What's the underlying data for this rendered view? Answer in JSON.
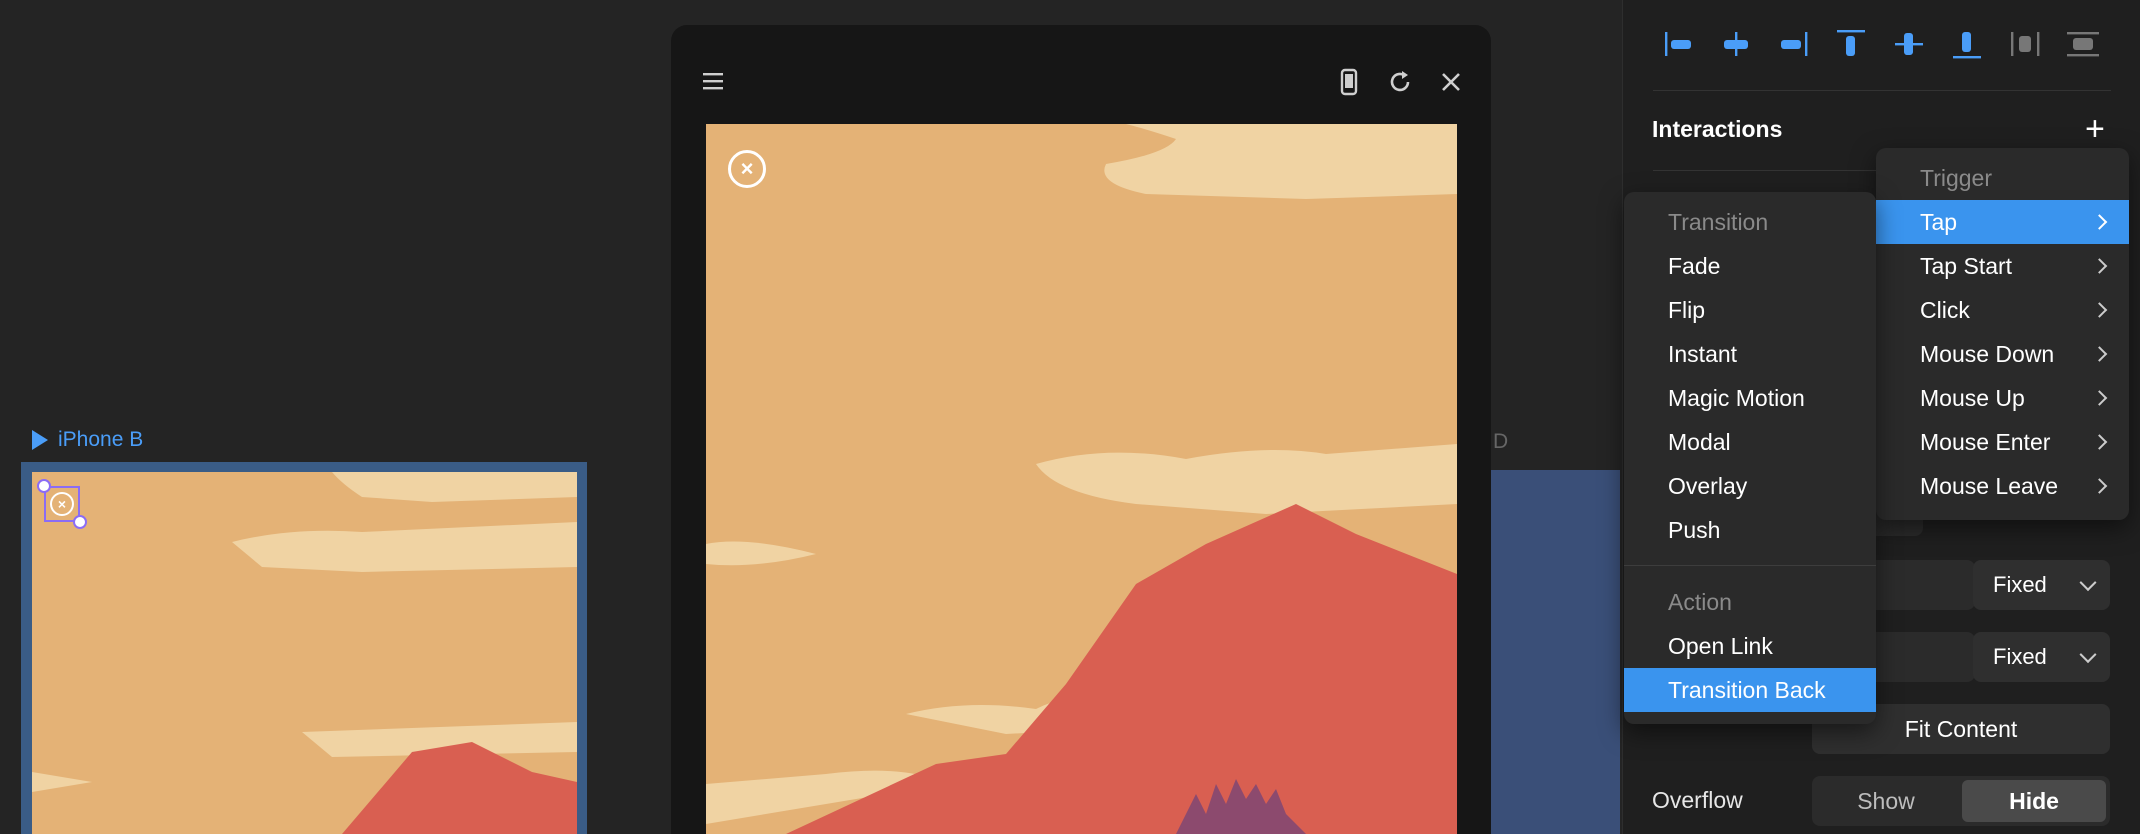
{
  "canvas": {
    "frame_b_label": "iPhone B",
    "frame_d_label": "D"
  },
  "preview": {
    "menu_icon": "menu-icon",
    "device_icon": "device-icon",
    "refresh_icon": "refresh-icon",
    "close_icon": "close-icon",
    "close_glyph": "×"
  },
  "panel": {
    "interactions_title": "Interactions",
    "add_symbol": "+",
    "size_width_mode": "Fixed",
    "size_height_mode": "Fixed",
    "fit_content_label": "Fit Content",
    "overflow_label": "Overflow",
    "overflow_options": [
      "Show",
      "Hide"
    ],
    "overflow_selected": "Hide"
  },
  "trigger_menu": {
    "header": "Trigger",
    "items": [
      "Tap",
      "Tap Start",
      "Click",
      "Mouse Down",
      "Mouse Up",
      "Mouse Enter",
      "Mouse Leave"
    ],
    "selected": "Tap"
  },
  "transition_menu": {
    "transition_header": "Transition",
    "transition_items": [
      "Fade",
      "Flip",
      "Instant",
      "Magic Motion",
      "Modal",
      "Overlay",
      "Push"
    ],
    "action_header": "Action",
    "action_items": [
      "Open Link",
      "Transition Back"
    ],
    "selected": "Transition Back"
  },
  "colors": {
    "accent": "#3a94ee",
    "sky": "#e4b276",
    "clouds": "#f0d3a3",
    "mountain": "#d95f51",
    "trees": "#8c4a6e"
  }
}
